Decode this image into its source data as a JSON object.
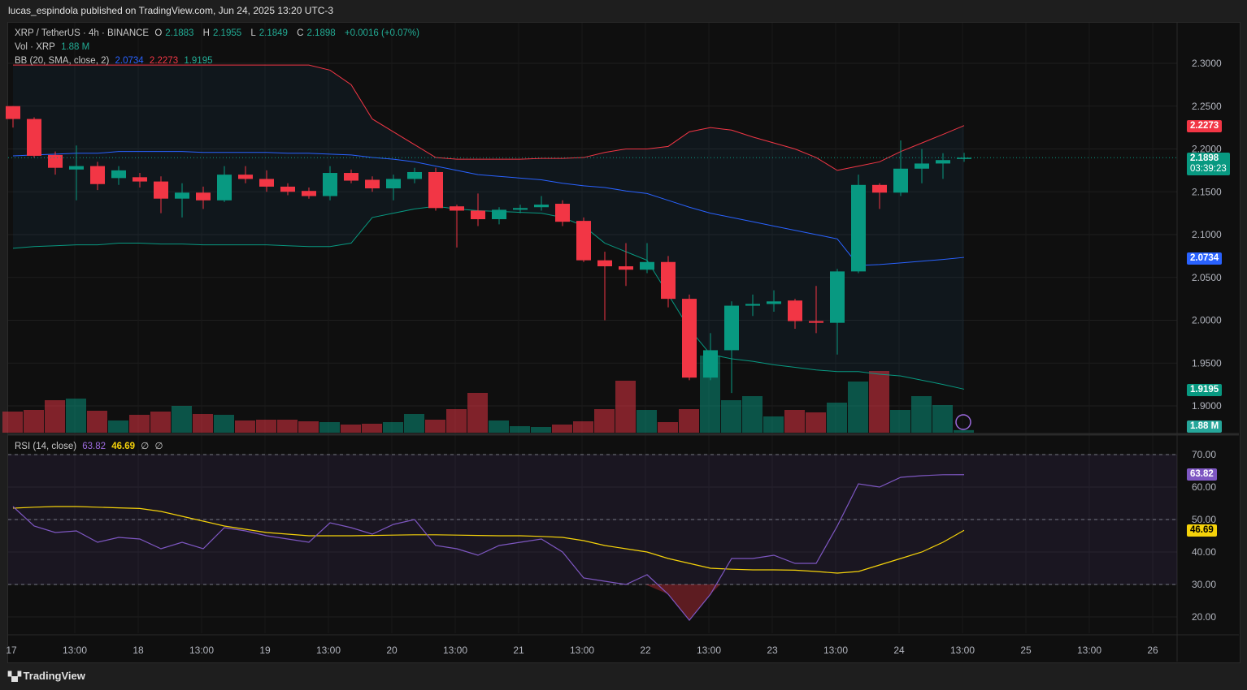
{
  "header": {
    "published": "lucas_espindola published on TradingView.com, Jun 24, 2025 13:20 UTC-3"
  },
  "legend": {
    "symbol": "XRP / TetherUS · 4h · BINANCE",
    "o_label": "O",
    "o": "2.1883",
    "h_label": "H",
    "h": "2.1955",
    "l_label": "L",
    "l": "2.1849",
    "c_label": "C",
    "c": "2.1898",
    "change": "+0.0016 (+0.07%)",
    "vol_label": "Vol · XRP",
    "vol": "1.88 M",
    "bb_label": "BB (20, SMA, close, 2)",
    "bb_mid": "2.0734",
    "bb_upper": "2.2273",
    "bb_lower": "1.9195",
    "rsi_label": "RSI (14, close)",
    "rsi": "63.82",
    "rsi_ma": "46.69",
    "rsi_x1": "∅",
    "rsi_x2": "∅"
  },
  "tags": {
    "upper": "2.2273",
    "price": "2.1898",
    "countdown": "03:39:23",
    "mid": "2.0734",
    "lower": "1.9195",
    "vol": "1.88 M",
    "rsi": "63.82",
    "rsi_ma": "46.69"
  },
  "brand": "TradingView",
  "colors": {
    "up": "#089981",
    "down": "#f23645",
    "mid": "#2962ff",
    "rsi": "#7e57c2",
    "rsi_ma": "#f5d20a"
  },
  "chart_data": {
    "type": "candlestick",
    "title": "XRP / TetherUS 4h BINANCE",
    "price_ticks": [
      "2.3000",
      "2.2500",
      "2.2000",
      "2.1500",
      "2.1000",
      "2.0500",
      "2.0000",
      "1.9500",
      "1.9000"
    ],
    "rsi_ticks": [
      "70.00",
      "60.00",
      "50.00",
      "40.00",
      "30.00",
      "20.00"
    ],
    "x_ticks": [
      "17",
      "13:00",
      "18",
      "13:00",
      "19",
      "13:00",
      "20",
      "13:00",
      "21",
      "13:00",
      "22",
      "13:00",
      "23",
      "13:00",
      "24",
      "13:00",
      "25",
      "13:00",
      "26"
    ],
    "ylim": [
      1.88,
      2.33
    ],
    "rsi_lim": [
      17,
      76
    ],
    "ohlc": [
      [
        2.25,
        2.25,
        2.225,
        2.235
      ],
      [
        2.235,
        2.237,
        2.19,
        2.192
      ],
      [
        2.193,
        2.197,
        2.17,
        2.178
      ],
      [
        2.176,
        2.204,
        2.14,
        2.18
      ],
      [
        2.18,
        2.185,
        2.152,
        2.159
      ],
      [
        2.166,
        2.18,
        2.158,
        2.175
      ],
      [
        2.167,
        2.172,
        2.155,
        2.162
      ],
      [
        2.162,
        2.168,
        2.125,
        2.142
      ],
      [
        2.142,
        2.16,
        2.12,
        2.149
      ],
      [
        2.149,
        2.156,
        2.13,
        2.14
      ],
      [
        2.14,
        2.18,
        2.138,
        2.17
      ],
      [
        2.17,
        2.18,
        2.16,
        2.165
      ],
      [
        2.165,
        2.175,
        2.15,
        2.156
      ],
      [
        2.156,
        2.16,
        2.146,
        2.15
      ],
      [
        2.151,
        2.155,
        2.142,
        2.145
      ],
      [
        2.145,
        2.18,
        2.14,
        2.172
      ],
      [
        2.172,
        2.176,
        2.16,
        2.163
      ],
      [
        2.164,
        2.168,
        2.15,
        2.154
      ],
      [
        2.154,
        2.17,
        2.14,
        2.165
      ],
      [
        2.165,
        2.178,
        2.16,
        2.173
      ],
      [
        2.173,
        2.178,
        2.128,
        2.131
      ],
      [
        2.133,
        2.135,
        2.085,
        2.128
      ],
      [
        2.128,
        2.148,
        2.11,
        2.118
      ],
      [
        2.118,
        2.132,
        2.112,
        2.129
      ],
      [
        2.129,
        2.135,
        2.125,
        2.131
      ],
      [
        2.132,
        2.145,
        2.128,
        2.135
      ],
      [
        2.136,
        2.14,
        2.11,
        2.115
      ],
      [
        2.116,
        2.12,
        2.068,
        2.07
      ],
      [
        2.07,
        2.08,
        2.0,
        2.063
      ],
      [
        2.063,
        2.09,
        2.04,
        2.059
      ],
      [
        2.059,
        2.09,
        2.055,
        2.068
      ],
      [
        2.068,
        2.075,
        2.015,
        2.025
      ],
      [
        2.025,
        2.03,
        1.93,
        1.933
      ],
      [
        1.933,
        1.985,
        1.93,
        1.965
      ],
      [
        1.965,
        2.022,
        1.915,
        2.017
      ],
      [
        2.017,
        2.03,
        2.005,
        2.019
      ],
      [
        2.019,
        2.035,
        2.01,
        2.022
      ],
      [
        2.023,
        2.025,
        1.99,
        1.999
      ],
      [
        1.999,
        2.04,
        1.985,
        1.997
      ],
      [
        1.997,
        2.06,
        1.96,
        2.057
      ],
      [
        2.057,
        2.17,
        2.055,
        2.158
      ],
      [
        2.158,
        2.16,
        2.13,
        2.149
      ],
      [
        2.149,
        2.21,
        2.145,
        2.177
      ],
      [
        2.177,
        2.2,
        2.16,
        2.183
      ],
      [
        2.183,
        2.195,
        2.165,
        2.187
      ],
      [
        2.1883,
        2.1955,
        2.1849,
        2.1898
      ]
    ],
    "volume_m": [
      15.6,
      16.8,
      24,
      25.2,
      16.2,
      9,
      13.2,
      15.6,
      19.8,
      13.8,
      13.2,
      9,
      9.6,
      9.6,
      8.4,
      7.8,
      6,
      6.6,
      7.8,
      13.8,
      9.6,
      17.4,
      29.4,
      9,
      4.8,
      4.2,
      6,
      8.4,
      17.4,
      38.4,
      16.8,
      7.8,
      17.4,
      57,
      24,
      27,
      12,
      16.8,
      15,
      22.2,
      37.8,
      45.6,
      16.8,
      27,
      20.4,
      1.88
    ],
    "bb_upper": [
      2.298,
      2.298,
      2.298,
      2.298,
      2.298,
      2.298,
      2.298,
      2.298,
      2.298,
      2.298,
      2.298,
      2.298,
      2.298,
      2.298,
      2.298,
      2.292,
      2.275,
      2.235,
      2.22,
      2.205,
      2.19,
      2.188,
      2.188,
      2.188,
      2.188,
      2.189,
      2.189,
      2.19,
      2.196,
      2.2,
      2.2,
      2.203,
      2.22,
      2.225,
      2.222,
      2.214,
      2.207,
      2.2,
      2.19,
      2.175,
      2.18,
      2.185,
      2.197,
      2.207,
      2.217,
      2.2273
    ],
    "bb_mid": [
      2.192,
      2.193,
      2.194,
      2.195,
      2.195,
      2.197,
      2.197,
      2.197,
      2.197,
      2.196,
      2.196,
      2.196,
      2.196,
      2.195,
      2.195,
      2.194,
      2.193,
      2.19,
      2.188,
      2.185,
      2.18,
      2.175,
      2.17,
      2.168,
      2.166,
      2.164,
      2.16,
      2.157,
      2.155,
      2.151,
      2.148,
      2.14,
      2.132,
      2.125,
      2.12,
      2.115,
      2.11,
      2.105,
      2.1,
      2.095,
      2.064,
      2.065,
      2.067,
      2.069,
      2.071,
      2.0734
    ],
    "bb_lower": [
      2.084,
      2.086,
      2.087,
      2.088,
      2.088,
      2.09,
      2.09,
      2.089,
      2.089,
      2.088,
      2.088,
      2.088,
      2.088,
      2.087,
      2.086,
      2.086,
      2.09,
      2.12,
      2.125,
      2.13,
      2.133,
      2.13,
      2.128,
      2.127,
      2.126,
      2.125,
      2.12,
      2.11,
      2.09,
      2.08,
      2.07,
      2.03,
      1.99,
      1.96,
      1.955,
      1.952,
      1.948,
      1.945,
      1.942,
      1.94,
      1.94,
      1.937,
      1.935,
      1.93,
      1.925,
      1.9195
    ],
    "rsi": [
      54,
      48,
      46,
      46.5,
      43,
      44.5,
      44,
      41,
      43,
      41,
      47.5,
      46.5,
      45,
      44,
      43,
      49,
      47.5,
      45.5,
      48.5,
      50,
      42,
      41,
      39,
      42,
      43,
      44,
      40,
      32,
      31,
      30,
      33,
      27,
      19,
      27,
      38,
      38,
      39,
      36.5,
      36.5,
      48,
      61,
      60,
      63,
      63.5,
      63.8,
      63.82
    ],
    "rsi_ma": [
      53.5,
      53.8,
      54,
      54,
      53.8,
      53.6,
      53.4,
      52.5,
      51,
      49.5,
      48,
      47,
      46,
      45.5,
      45,
      45,
      45,
      45.1,
      45.2,
      45.3,
      45.3,
      45.2,
      45.1,
      45,
      45,
      44.8,
      44.5,
      43.5,
      42,
      41,
      40,
      38,
      36.5,
      35,
      34.7,
      34.5,
      34.5,
      34.4,
      34,
      33.5,
      34,
      36,
      38,
      40,
      43,
      46.69
    ]
  }
}
